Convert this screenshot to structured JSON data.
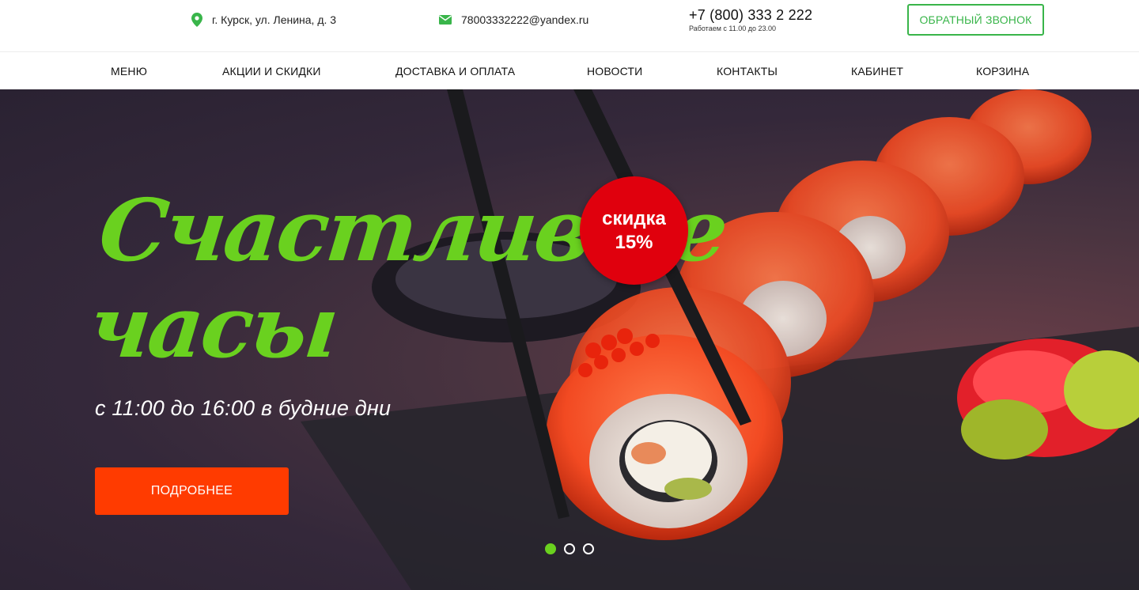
{
  "topbar": {
    "address": "г. Курск, ул. Ленина, д. 3",
    "email": "78003332222@yandex.ru",
    "phone": "+7 (800) 333 2 222",
    "hours": "Работаем с 11.00 до 23.00",
    "callback_label": "ОБРАТНЫЙ ЗВОНОК",
    "accent_color": "#39b54a"
  },
  "nav": {
    "items": [
      {
        "label": "МЕНЮ"
      },
      {
        "label": "АКЦИИ И СКИДКИ"
      },
      {
        "label": "ДОСТАВКА И ОПЛАТА"
      },
      {
        "label": "НОВОСТИ"
      },
      {
        "label": "КОНТАКТЫ"
      },
      {
        "label": "КАБИНЕТ"
      },
      {
        "label": "КОРЗИНА"
      }
    ]
  },
  "hero": {
    "title_line1": "Счастливые",
    "title_line2": "часы",
    "subtitle": "с 11:00 до 16:00 в будние дни",
    "cta_label": "ПОДРОБНЕЕ",
    "badge_line1": "скидка",
    "badge_line2": "15%",
    "title_color": "#6ad11f",
    "cta_color": "#ff3b00",
    "badge_color": "#e0000d",
    "slides_total": 3,
    "slide_active": 1
  }
}
